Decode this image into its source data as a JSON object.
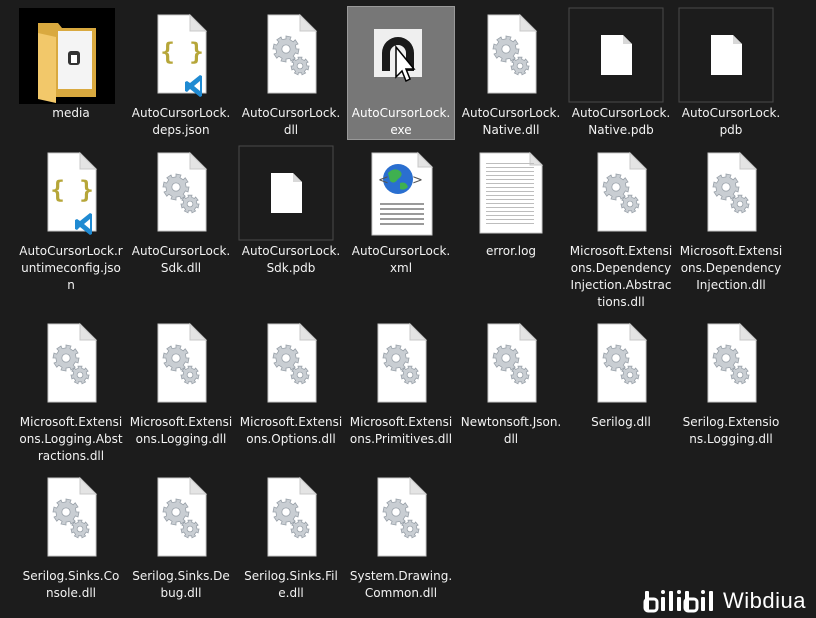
{
  "files": [
    {
      "label": "media",
      "kind": "folder",
      "selected": false
    },
    {
      "label": "AutoCursorLock.deps.json",
      "kind": "json",
      "selected": false
    },
    {
      "label": "AutoCursorLock.dll",
      "kind": "dll",
      "selected": false
    },
    {
      "label": "AutoCursorLock.exe",
      "kind": "exe",
      "selected": true
    },
    {
      "label": "AutoCursorLock.Native.dll",
      "kind": "dll",
      "selected": false
    },
    {
      "label": "AutoCursorLock.Native.pdb",
      "kind": "blank",
      "selected": false
    },
    {
      "label": "AutoCursorLock.pdb",
      "kind": "blank",
      "selected": false
    },
    {
      "label": "AutoCursorLock.runtimeconfig.json",
      "kind": "json",
      "selected": false
    },
    {
      "label": "AutoCursorLock.Sdk.dll",
      "kind": "dll",
      "selected": false
    },
    {
      "label": "AutoCursorLock.Sdk.pdb",
      "kind": "blank",
      "selected": false
    },
    {
      "label": "AutoCursorLock.xml",
      "kind": "xml",
      "selected": false
    },
    {
      "label": "error.log",
      "kind": "log",
      "selected": false
    },
    {
      "label": "Microsoft.Extensions.DependencyInjection.Abstractions.dll",
      "kind": "dll",
      "selected": false
    },
    {
      "label": "Microsoft.Extensions.DependencyInjection.dll",
      "kind": "dll",
      "selected": false
    },
    {
      "label": "Microsoft.Extensions.Logging.Abstractions.dll",
      "kind": "dll",
      "selected": false
    },
    {
      "label": "Microsoft.Extensions.Logging.dll",
      "kind": "dll",
      "selected": false
    },
    {
      "label": "Microsoft.Extensions.Options.dll",
      "kind": "dll",
      "selected": false
    },
    {
      "label": "Microsoft.Extensions.Primitives.dll",
      "kind": "dll",
      "selected": false
    },
    {
      "label": "Newtonsoft.Json.dll",
      "kind": "dll",
      "selected": false
    },
    {
      "label": "Serilog.dll",
      "kind": "dll",
      "selected": false
    },
    {
      "label": "Serilog.Extensions.Logging.dll",
      "kind": "dll",
      "selected": false
    },
    {
      "label": "Serilog.Sinks.Console.dll",
      "kind": "dll",
      "selected": false
    },
    {
      "label": "Serilog.Sinks.Debug.dll",
      "kind": "dll",
      "selected": false
    },
    {
      "label": "Serilog.Sinks.File.dll",
      "kind": "dll",
      "selected": false
    },
    {
      "label": "System.Drawing.Common.dll",
      "kind": "dll",
      "selected": false
    }
  ],
  "watermark": {
    "text": "Wibdiua",
    "logo": "bilibili"
  },
  "colors": {
    "background": "#1c1c1c",
    "selection": "#777777",
    "folder": "#f2c86a",
    "json_brace": "#b6a639",
    "vscode_blue": "#1f8ad2"
  }
}
